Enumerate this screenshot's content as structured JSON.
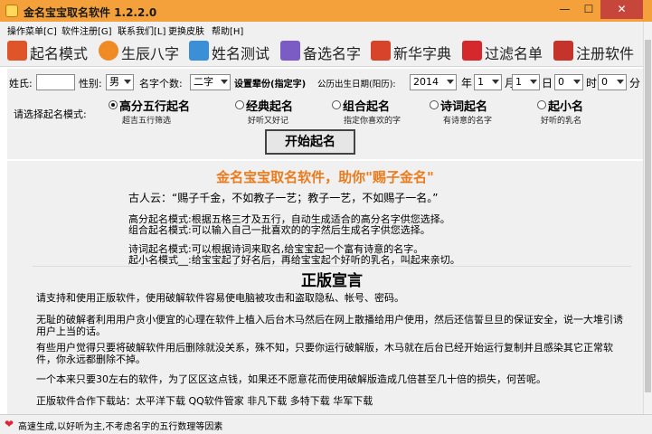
{
  "window": {
    "title": "金名宝宝取名软件 1.2.2.0",
    "min_icon": "minimize-icon",
    "max_icon": "maximize-icon",
    "close_icon": "close-icon"
  },
  "menu": [
    "操作菜单[C]",
    "软件注册[G]",
    "联系我们[L]",
    "更换皮肤",
    "帮助[H]"
  ],
  "toolbar": [
    {
      "label": "起名模式",
      "icon": "name-mode-icon",
      "color": "#e0542a"
    },
    {
      "label": "生辰八字",
      "icon": "clock-icon",
      "color": "#f08a24"
    },
    {
      "label": "姓名测试",
      "icon": "name-test-icon",
      "color": "#3a8fd6"
    },
    {
      "label": "备选名字",
      "icon": "calendar-icon",
      "color": "#7a5cc4"
    },
    {
      "label": "新华字典",
      "icon": "dictionary-icon",
      "color": "#d8432c"
    },
    {
      "label": "过滤名单",
      "icon": "filter-x-icon",
      "color": "#d4282c"
    },
    {
      "label": "注册软件",
      "icon": "register-icon",
      "color": "#c4342a"
    }
  ],
  "form": {
    "surname_label": "姓氏:",
    "surname_value": "",
    "gender_label": "性别:",
    "gender_value": "男",
    "count_label": "名字个数:",
    "count_value": "二字",
    "set_label": "设置辈份(指定字)",
    "birth_label": "公历出生日期(阳历):",
    "year_value": "2014",
    "year_unit": "年",
    "month_value": "1",
    "month_unit": "月",
    "day_value": "1",
    "day_unit": "日",
    "hour_value": "0",
    "hour_unit": "时",
    "minute_value": "0",
    "minute_unit": "分",
    "mode_prompt": "请选择起名模式:",
    "modes": [
      {
        "title": "高分五行起名",
        "desc": "超吉五行筛选",
        "selected": true
      },
      {
        "title": "经典起名",
        "desc": "好听又好记",
        "selected": false
      },
      {
        "title": "组合起名",
        "desc": "指定你喜欢的字",
        "selected": false
      },
      {
        "title": "诗词起名",
        "desc": "有诗意的名字",
        "selected": false
      },
      {
        "title": "起小名",
        "desc": "好听的乳名",
        "selected": false
      }
    ],
    "start_button": "开始起名"
  },
  "content": {
    "slogan": "金名宝宝取名软件，助你\"赐子金名\"",
    "quote": "古人云：“赐子千金，不如教子一艺；教子一艺，不如赐子一名。”",
    "desc1": "高分起名模式:根据五格三才及五行，自动生成适合的高分名字供您选择。",
    "desc2": "组合起名模式:可以输入自己一批喜欢的的字然后生成名字供您选择。",
    "desc3": "诗词起名模式:可以根据诗词来取名,给宝宝起一个富有诗意的名字。",
    "desc4": "起小名模式__:给宝宝起了好名后，再给宝宝起个好听的乳名，叫起来亲切。",
    "notice_title": "正版宣言",
    "notice_p1": "请支持和使用正版软件，使用破解软件容易使电脑被攻击和盗取隐私、帐号、密码。",
    "notice_p2": "无耻的破解者利用用户贪小便宜的心理在软件上植入后台木马然后在网上散播给用户使用，然后还信誓旦旦的保证安全，说一大堆引诱用户上当的话。",
    "notice_p3": "有些用户觉得只要将破解软件用后删除就没关系，殊不知，只要你运行破解版，木马就在后台已经开始运行复制并且感染其它正常软件，你永远都删除不掉。",
    "notice_p4": "一个本来只要30左右的软件，为了区区这点钱，如果还不愿意花而使用破解版造成几倍甚至几十倍的损失，何苦呢。",
    "notice_p5": "正版软件合作下载站：太平洋下载  QQ软件管家  非凡下载  多特下载  华军下载"
  },
  "status": {
    "icon": "heart-icon",
    "text": "高速生成,以好听为主,不考虑名字的五行数理等因素"
  }
}
